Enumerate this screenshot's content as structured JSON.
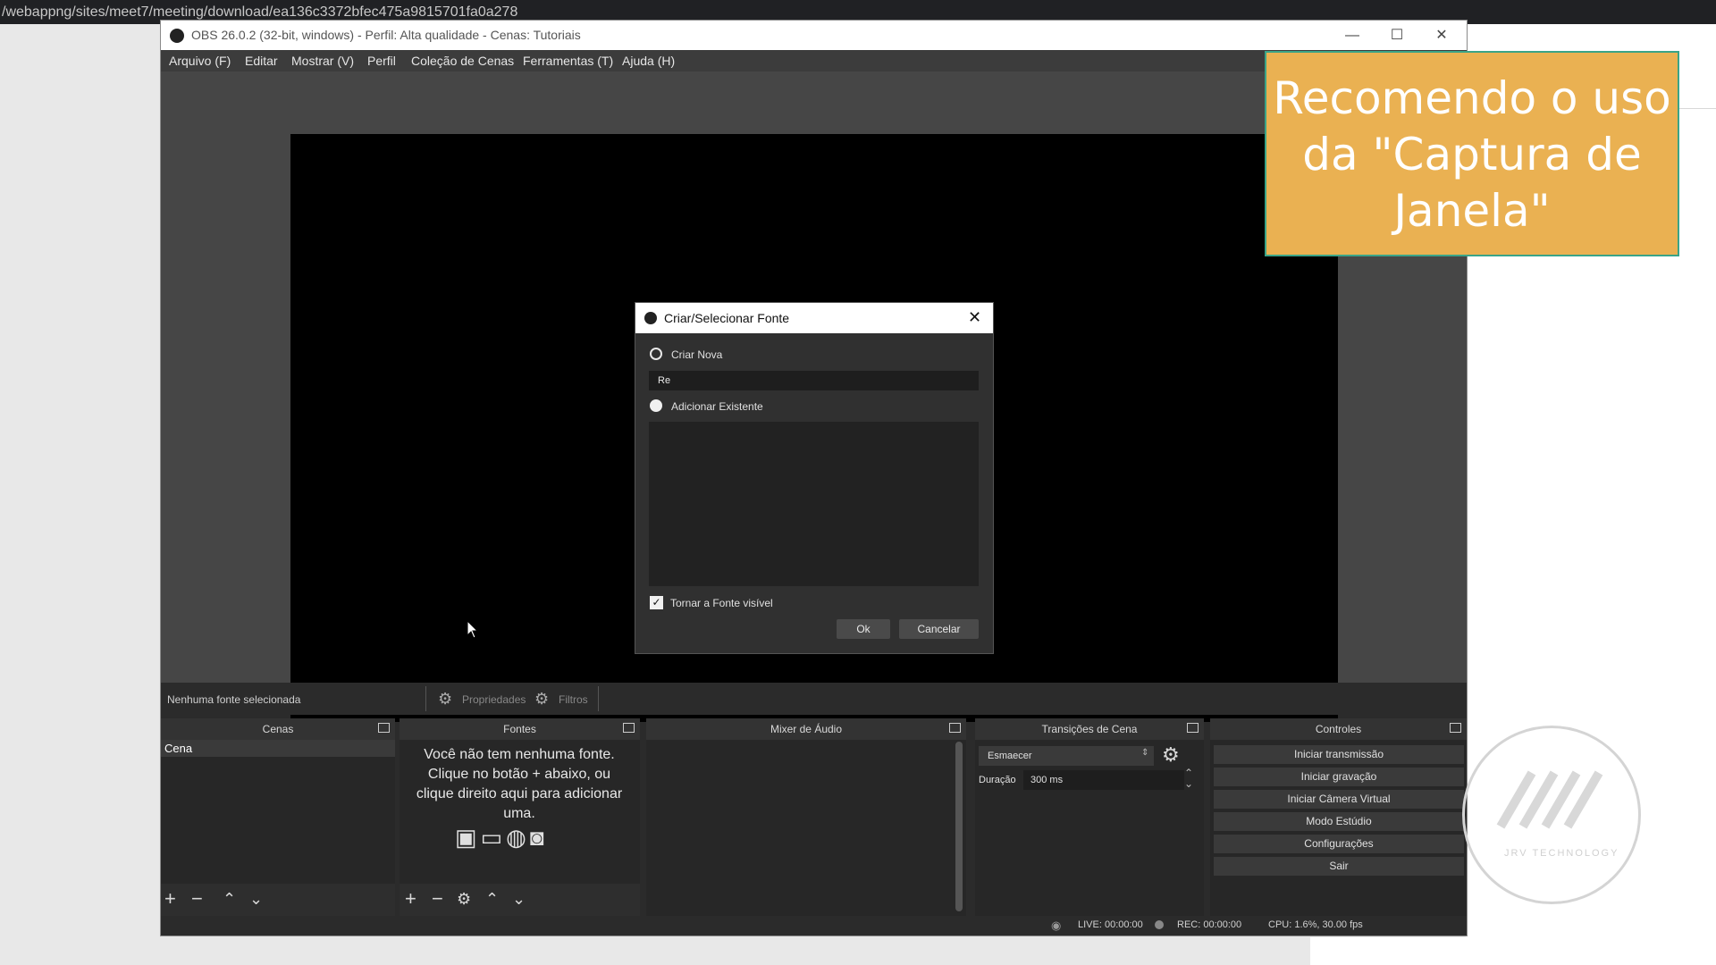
{
  "browser": {
    "url": "/webappng/sites/meet7/meeting/download/ea136c3372bfec475a9815701fa0a278"
  },
  "window": {
    "title": "OBS 26.0.2 (32-bit, windows) - Perfil: Alta qualidade - Cenas: Tutoriais",
    "minimize": "—",
    "maximize": "☐",
    "close": "✕"
  },
  "menu": [
    "Arquivo (F)",
    "Editar",
    "Mostrar (V)",
    "Perfil",
    "Coleção de Cenas",
    "Ferramentas (T)",
    "Ajuda (H)"
  ],
  "source_toolbar": {
    "status": "Nenhuma fonte selecionada",
    "properties": "Propriedades",
    "filters": "Filtros"
  },
  "docks": {
    "scenes": {
      "title": "Cenas",
      "items": [
        "Cena"
      ]
    },
    "sources": {
      "title": "Fontes",
      "empty_message": "Você não tem nenhuma fonte. Clique no botão + abaixo, ou clique direito aqui para adicionar uma."
    },
    "mixer": {
      "title": "Mixer de Áudio"
    },
    "transitions": {
      "title": "Transições de Cena",
      "transition": "Esmaecer",
      "duration_label": "Duração",
      "duration_value": "300 ms"
    },
    "controls": {
      "title": "Controles",
      "buttons": [
        "Iniciar transmissão",
        "Iniciar gravação",
        "Iniciar Câmera Virtual",
        "Modo Estúdio",
        "Configurações",
        "Sair"
      ]
    }
  },
  "statusbar": {
    "live": "LIVE: 00:00:00",
    "rec": "REC: 00:00:00",
    "cpu": "CPU: 1.6%, 30.00 fps"
  },
  "dialog": {
    "title": "Criar/Selecionar Fonte",
    "create_new": "Criar Nova",
    "name_value": "Re",
    "add_existing": "Adicionar Existente",
    "make_visible": "Tornar a Fonte visível",
    "ok": "Ok",
    "cancel": "Cancelar"
  },
  "callout": {
    "text": "Recomendo o uso da \"Captura de Janela\""
  },
  "watermark": {
    "text": "JRV TECHNOLOGY"
  },
  "colors": {
    "callout_bg": "#eab152",
    "callout_border": "#3aa487",
    "obs_dark": "#2b2b2b"
  }
}
